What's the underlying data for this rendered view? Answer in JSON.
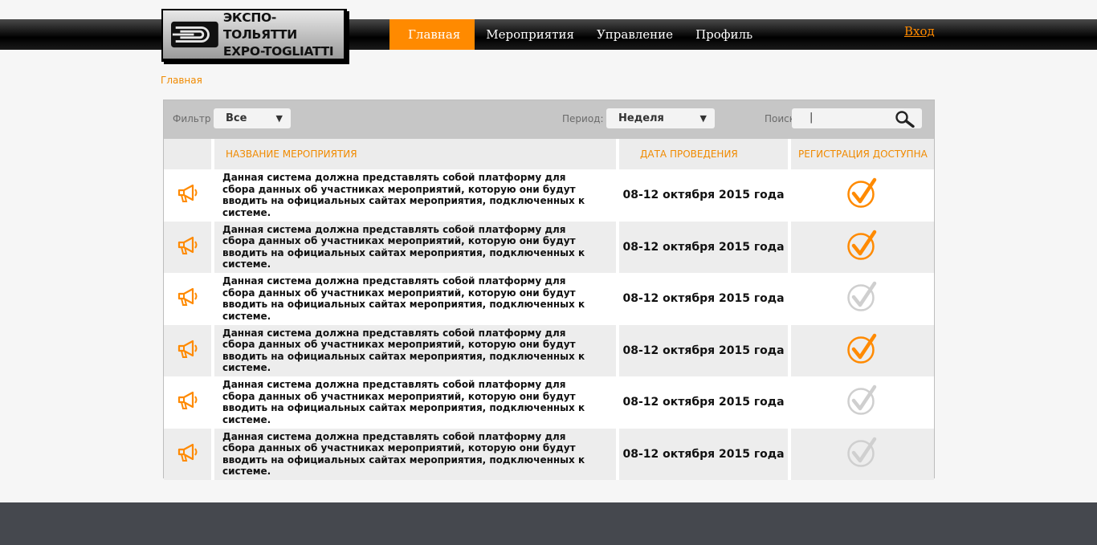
{
  "logo": {
    "line1": "ЭКСПО-ТОЛЬЯТТИ",
    "line2": "EXPO-TOGLIATTI"
  },
  "nav": {
    "items": [
      {
        "label": "Главная",
        "active": true
      },
      {
        "label": "Мероприятия",
        "active": false
      },
      {
        "label": "Управление",
        "active": false
      },
      {
        "label": "Профиль",
        "active": false
      }
    ],
    "login": "Вход"
  },
  "breadcrumb": "Главная",
  "filters": {
    "filter_label": "Фильтр",
    "filter_value": "Все",
    "period_label": "Период:",
    "period_value": "Неделя",
    "search_label": "Поиск:",
    "search_value": "|"
  },
  "table": {
    "columns": [
      "НАЗВАНИЕ МЕРОПРИЯТИЯ",
      "ДАТА ПРОВЕДЕНИЯ",
      "РЕГИСТРАЦИЯ ДОСТУПНА"
    ],
    "rows": [
      {
        "name": "Данная система должна представлять собой платформу для сбора данных об участниках мероприятий, которую они будут вводить на официальных сайтах мероприятия, подключенных к системе.",
        "date": "08-12 октября 2015 года",
        "registration": true
      },
      {
        "name": "Данная система должна представлять собой платформу для сбора данных об участниках мероприятий, которую они будут вводить на официальных сайтах мероприятия, подключенных к системе.",
        "date": "08-12 октября 2015 года",
        "registration": true
      },
      {
        "name": "Данная система должна представлять собой платформу для сбора данных об участниках мероприятий, которую они будут вводить на официальных сайтах мероприятия, подключенных к системе.",
        "date": "08-12 октября 2015 года",
        "registration": false
      },
      {
        "name": "Данная система должна представлять собой платформу для сбора данных об участниках мероприятий, которую они будут вводить на официальных сайтах мероприятия, подключенных к системе.",
        "date": "08-12 октября 2015 года",
        "registration": true
      },
      {
        "name": "Данная система должна представлять собой платформу для сбора данных об участниках мероприятий, которую они будут вводить на официальных сайтах мероприятия, подключенных к системе.",
        "date": "08-12 октября 2015 года",
        "registration": false
      },
      {
        "name": "Данная система должна представлять собой платформу для сбора данных об участниках мероприятий, которую они будут вводить на официальных сайтах мероприятия, подключенных к системе.",
        "date": "08-12 октября 2015 года",
        "registration": false
      }
    ]
  },
  "icons": {
    "row_icon": "megaphone-icon",
    "reg_icon": "check-circle-icon",
    "search_icon": "magnifier-icon"
  },
  "colors": {
    "accent": "#ff8a00",
    "check_on": "#ff8a00",
    "check_off": "#cfcfcf",
    "footer": "#45484e"
  }
}
